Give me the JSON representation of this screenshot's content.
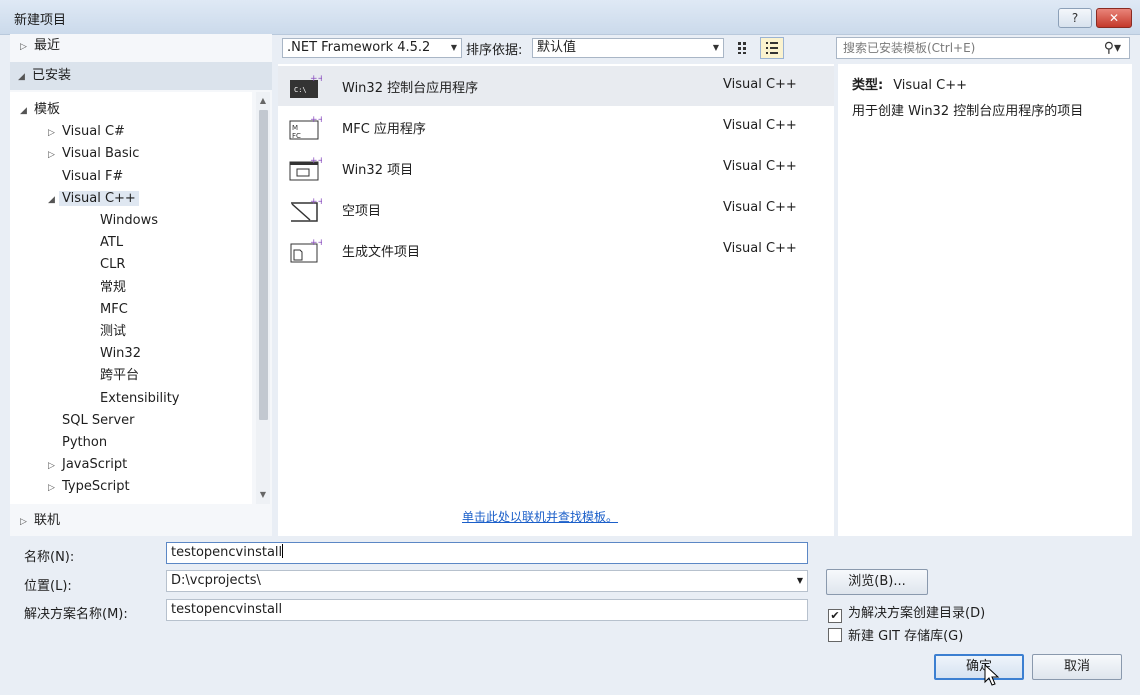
{
  "window": {
    "title": "新建项目",
    "help_label": "?",
    "close_label": "✕"
  },
  "left_pane": {
    "recent": "最近",
    "installed": "已安装",
    "online": "联机",
    "tree": [
      {
        "label": "模板",
        "arrow": "◢",
        "indent": 0
      },
      {
        "label": "Visual C#",
        "arrow": "▷",
        "indent": 1
      },
      {
        "label": "Visual Basic",
        "arrow": "▷",
        "indent": 1
      },
      {
        "label": "Visual F#",
        "arrow": "",
        "indent": 1
      },
      {
        "label": "Visual C++",
        "arrow": "◢",
        "indent": 1,
        "selected": true
      },
      {
        "label": "Windows",
        "arrow": "",
        "indent": 2
      },
      {
        "label": "ATL",
        "arrow": "",
        "indent": 2
      },
      {
        "label": "CLR",
        "arrow": "",
        "indent": 2
      },
      {
        "label": "常规",
        "arrow": "",
        "indent": 2
      },
      {
        "label": "MFC",
        "arrow": "",
        "indent": 2
      },
      {
        "label": "测试",
        "arrow": "",
        "indent": 2
      },
      {
        "label": "Win32",
        "arrow": "",
        "indent": 2
      },
      {
        "label": "跨平台",
        "arrow": "",
        "indent": 2
      },
      {
        "label": "Extensibility",
        "arrow": "",
        "indent": 2
      },
      {
        "label": "SQL Server",
        "arrow": "",
        "indent": 1
      },
      {
        "label": "Python",
        "arrow": "",
        "indent": 1
      },
      {
        "label": "JavaScript",
        "arrow": "▷",
        "indent": 1
      },
      {
        "label": "TypeScript",
        "arrow": "▷",
        "indent": 1
      }
    ]
  },
  "toolbar": {
    "framework": ".NET Framework 4.5.2",
    "sort_label": "排序依据:",
    "sort_value": "默认值",
    "search_placeholder": "搜索已安装模板(Ctrl+E)"
  },
  "templates": [
    {
      "name": "Win32 控制台应用程序",
      "lang": "Visual C++",
      "icon": "console-app-icon",
      "selected": true
    },
    {
      "name": "MFC 应用程序",
      "lang": "Visual C++",
      "icon": "mfc-app-icon"
    },
    {
      "name": "Win32 项目",
      "lang": "Visual C++",
      "icon": "win32-project-icon"
    },
    {
      "name": "空项目",
      "lang": "Visual C++",
      "icon": "empty-project-icon"
    },
    {
      "name": "生成文件项目",
      "lang": "Visual C++",
      "icon": "makefile-project-icon"
    }
  ],
  "find_online_link": "单击此处以联机并查找模板。",
  "description": {
    "type_label": "类型:",
    "type_value": "Visual C++",
    "text": "用于创建 Win32 控制台应用程序的项目"
  },
  "form": {
    "name_label": "名称(N):",
    "name_value": "testopencvinstall",
    "location_label": "位置(L):",
    "location_value": "D:\\vcprojects\\",
    "solution_label": "解决方案名称(M):",
    "solution_value": "testopencvinstall",
    "browse_label": "浏览(B)...",
    "create_dir_label": "为解决方案创建目录(D)",
    "create_dir_checked": true,
    "git_label": "新建 GIT 存储库(G)",
    "git_checked": false,
    "ok_label": "确定",
    "cancel_label": "取消"
  },
  "colors": {
    "accent": "#3c7fd1",
    "link": "#1b5fc9",
    "icon_plus": "#8a4fbf"
  }
}
